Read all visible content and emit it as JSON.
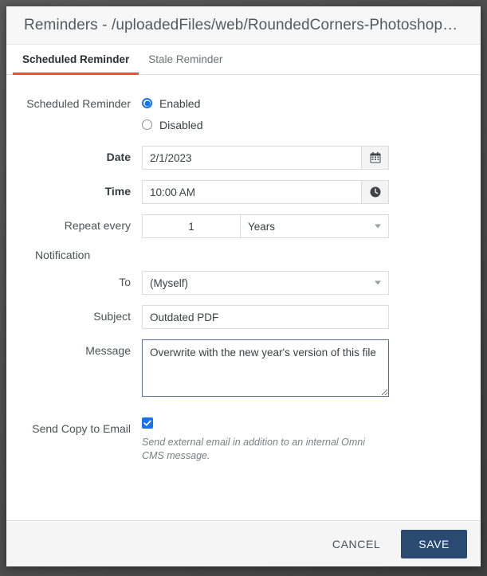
{
  "window": {
    "title": "Reminders - /uploadedFiles/web/RoundedCorners-Photoshop…"
  },
  "tabs": [
    {
      "label": "Scheduled Reminder",
      "active": true
    },
    {
      "label": "Stale Reminder",
      "active": false
    }
  ],
  "form": {
    "scheduled_reminder": {
      "label": "Scheduled Reminder",
      "options": [
        {
          "label": "Enabled",
          "selected": true
        },
        {
          "label": "Disabled",
          "selected": false
        }
      ]
    },
    "date": {
      "label": "Date",
      "value": "2/1/2023",
      "icon": "calendar-icon"
    },
    "time": {
      "label": "Time",
      "value": "10:00 AM",
      "icon": "clock-icon"
    },
    "repeat": {
      "label": "Repeat every",
      "count": "1",
      "unit": "Years"
    },
    "notification": {
      "section_title": "Notification",
      "to": {
        "label": "To",
        "value": "(Myself)"
      },
      "subject": {
        "label": "Subject",
        "value": "Outdated PDF"
      },
      "message": {
        "label": "Message",
        "value": "Overwrite with the new year's version of this file"
      }
    },
    "send_copy": {
      "label": "Send Copy to Email",
      "checked": true,
      "help": "Send external email in addition to an internal Omni CMS message."
    }
  },
  "footer": {
    "cancel_label": "CANCEL",
    "save_label": "SAVE"
  },
  "colors": {
    "accent_tab": "#f4511e",
    "save_button": "#2b4a72",
    "control_blue": "#1a73e8",
    "focus_border": "#5a7391"
  }
}
